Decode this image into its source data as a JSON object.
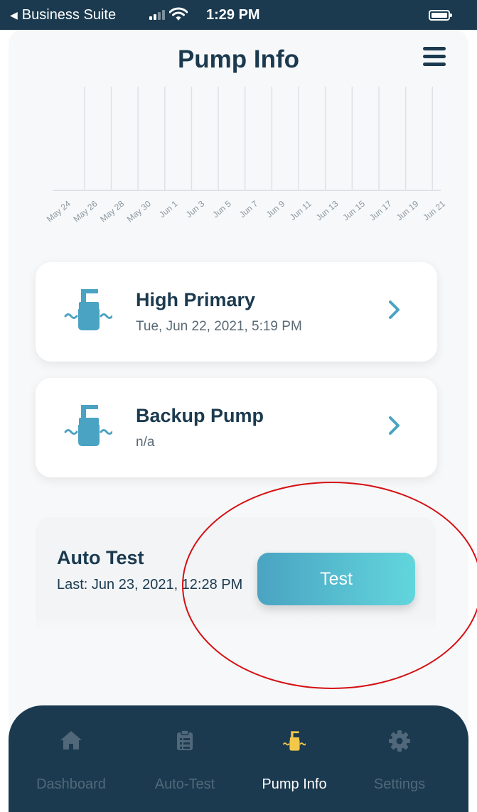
{
  "status_bar": {
    "back_label": "Business Suite",
    "time": "1:29 PM",
    "icons": [
      "signal-icon",
      "wifi-icon",
      "battery-icon"
    ]
  },
  "header": {
    "title": "Pump Info",
    "menu_icon": "hamburger-menu-icon"
  },
  "chart_data": {
    "type": "bar",
    "categories": [
      "May 24",
      "May 26",
      "May 28",
      "May 30",
      "Jun 1",
      "Jun 3",
      "Jun 5",
      "Jun 7",
      "Jun 9",
      "Jun 11",
      "Jun 13",
      "Jun 15",
      "Jun 17",
      "Jun 19",
      "Jun 21"
    ],
    "values": [],
    "grid": true,
    "legend": "none"
  },
  "pumps": [
    {
      "name": "High Primary",
      "subtitle": "Tue, Jun 22, 2021, 5:19 PM",
      "icon": "sump-pump-icon"
    },
    {
      "name": "Backup Pump",
      "subtitle": "n/a",
      "icon": "sump-pump-icon"
    }
  ],
  "auto_test": {
    "title": "Auto Test",
    "last": "Last: Jun 23, 2021, 12:28 PM",
    "button_label": "Test"
  },
  "tabs": [
    {
      "label": "Dashboard",
      "icon": "home-icon",
      "active": false
    },
    {
      "label": "Auto-Test",
      "icon": "clipboard-icon",
      "active": false
    },
    {
      "label": "Pump Info",
      "icon": "pump-icon",
      "active": true
    },
    {
      "label": "Settings",
      "icon": "gear-icon",
      "active": false
    }
  ],
  "colors": {
    "primary": "#1b3a4f",
    "accent": "#5bc0d4",
    "active_tab_icon": "#f2c84b",
    "annotation": "#d40f12"
  }
}
